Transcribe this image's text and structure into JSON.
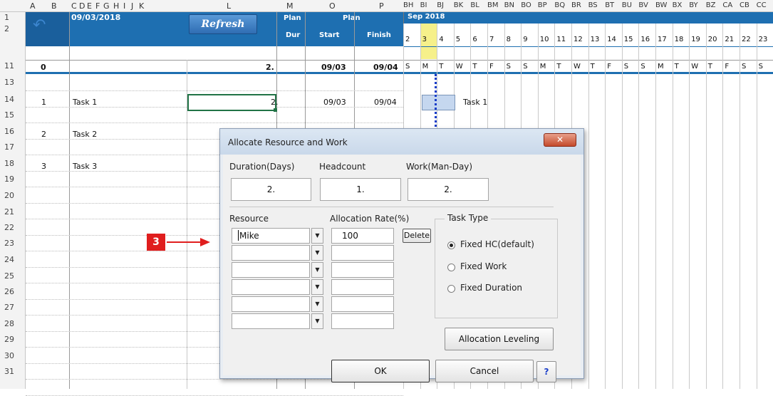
{
  "columns": {
    "left": [
      "A",
      "B",
      "C",
      "D",
      "E",
      "F",
      "G",
      "H",
      "I",
      "J",
      "K"
    ],
    "l": "L",
    "m": "M",
    "o": "O",
    "p": "P",
    "gantt": [
      "BH",
      "BI",
      "BJ",
      "BK",
      "BL",
      "BM",
      "BN",
      "BO",
      "BP",
      "BQ",
      "BR",
      "BS",
      "BT",
      "BU",
      "BV",
      "BW",
      "BX",
      "BY",
      "BZ",
      "CA",
      "CB",
      "CC"
    ]
  },
  "header": {
    "date": "09/03/2018",
    "refresh_label": "Refresh",
    "plan_dur_1": "Plan",
    "plan_dur_2": "Dur",
    "plan": "Plan",
    "start": "Start",
    "finish": "Finish",
    "month": "Sep 2018",
    "days": [
      "2",
      "3",
      "4",
      "5",
      "6",
      "7",
      "8",
      "9",
      "10",
      "11",
      "12",
      "13",
      "14",
      "15",
      "16",
      "17",
      "18",
      "19",
      "20",
      "21",
      "22",
      "23"
    ],
    "weekdays": [
      "S",
      "M",
      "T",
      "W",
      "T",
      "F",
      "S",
      "S",
      "M",
      "T",
      "W",
      "T",
      "F",
      "S",
      "S",
      "M",
      "T",
      "W",
      "T",
      "F",
      "S",
      "S"
    ]
  },
  "rows": {
    "numbers": [
      "1",
      "2",
      "11",
      "13",
      "14",
      "15",
      "16",
      "17",
      "18",
      "19",
      "20",
      "21",
      "22",
      "23",
      "24",
      "25",
      "26",
      "27",
      "28",
      "29",
      "30",
      "31"
    ],
    "summary": {
      "id": "0",
      "dur": "2.",
      "start": "09/03",
      "finish": "09/04"
    },
    "tasks": [
      {
        "id": "1",
        "name": "Task 1",
        "dur": "2.",
        "start": "09/03",
        "finish": "09/04"
      },
      {
        "id": "2",
        "name": "Task 2"
      },
      {
        "id": "3",
        "name": "Task 3"
      }
    ],
    "gantt_label": "Task 1"
  },
  "annotation": {
    "step": "3"
  },
  "dialog": {
    "title": "Allocate Resource and Work",
    "close": "✕",
    "duration_label": "Duration(Days)",
    "headcount_label": "Headcount",
    "work_label": "Work(Man-Day)",
    "duration_value": "2.",
    "headcount_value": "1.",
    "work_value": "2.",
    "resource_label": "Resource",
    "rate_label": "Allocation Rate(%)",
    "resources": [
      {
        "name": "Mike",
        "rate": "100"
      },
      {
        "name": "",
        "rate": ""
      },
      {
        "name": "",
        "rate": ""
      },
      {
        "name": "",
        "rate": ""
      },
      {
        "name": "",
        "rate": ""
      },
      {
        "name": "",
        "rate": ""
      }
    ],
    "delete_label": "Delete",
    "task_type_label": "Task Type",
    "task_types": [
      "Fixed HC(default)",
      "Fixed Work",
      "Fixed Duration"
    ],
    "selected_task_type": "Fixed HC(default)",
    "leveling_label": "Allocation Leveling",
    "ok_label": "OK",
    "cancel_label": "Cancel",
    "help_label": "?"
  }
}
